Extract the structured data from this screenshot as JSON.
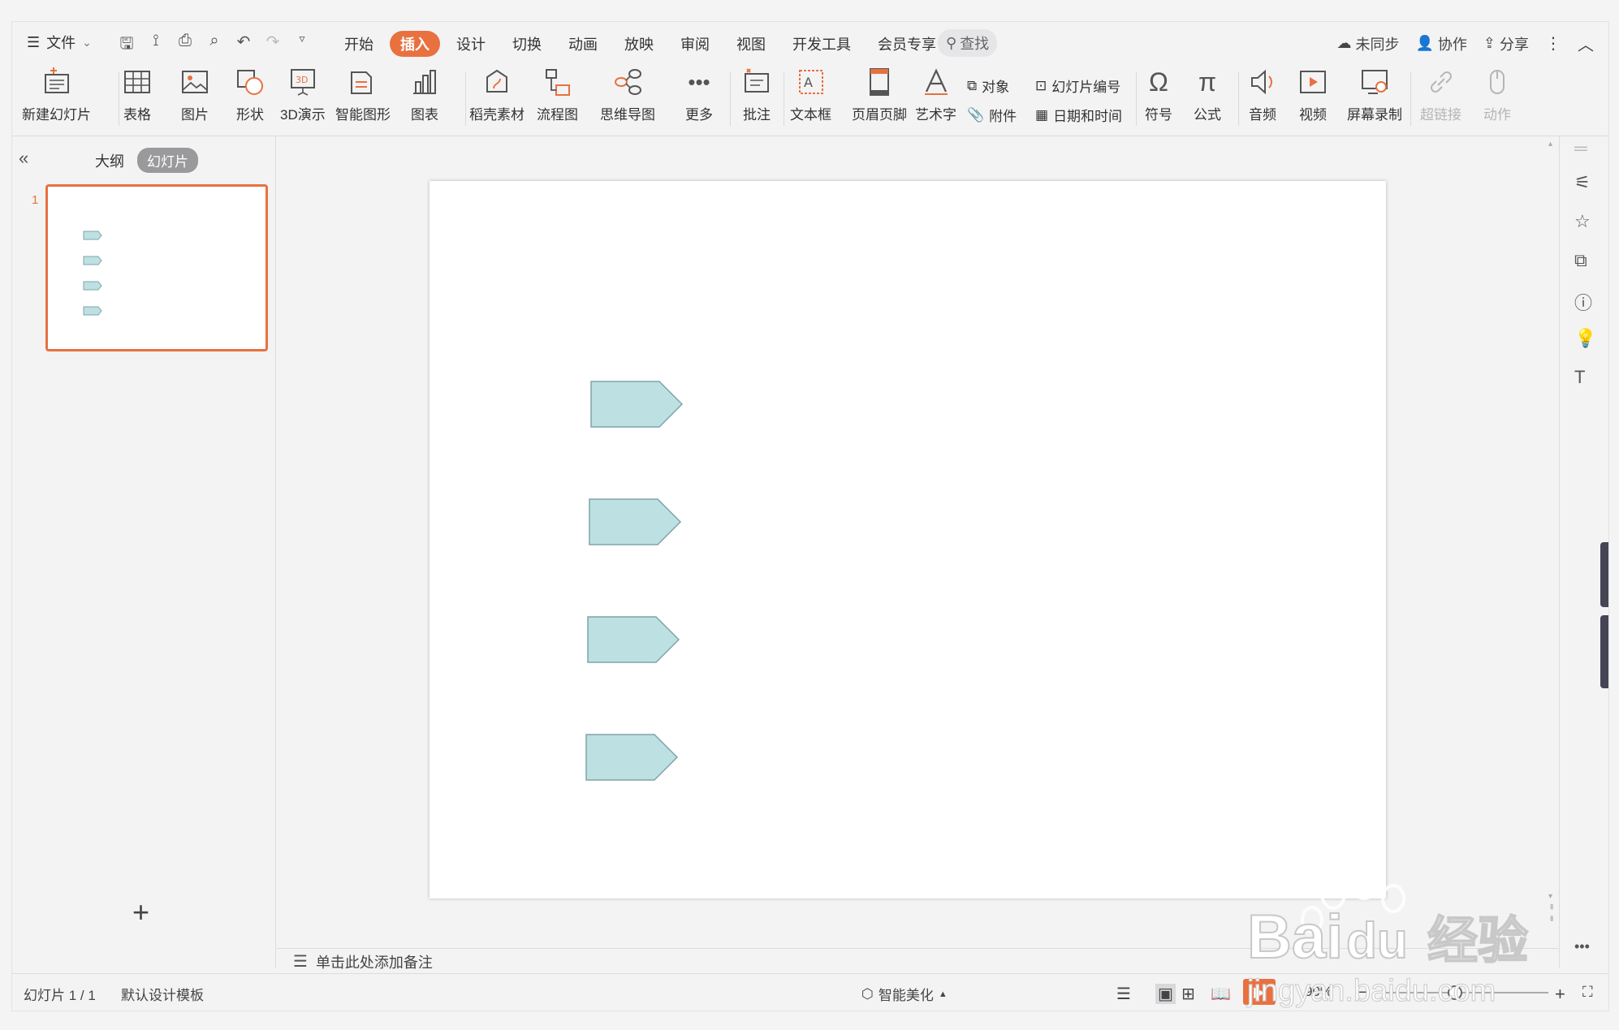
{
  "menu": {
    "file_label": "文件",
    "tabs": [
      "开始",
      "插入",
      "设计",
      "切换",
      "动画",
      "放映",
      "审阅",
      "视图",
      "开发工具",
      "会员专享"
    ],
    "active_tab": "插入",
    "search_label": "查找",
    "right_items": [
      "未同步",
      "协作",
      "分享"
    ]
  },
  "ribbon": {
    "new_slide": "新建幻灯片",
    "table": "表格",
    "picture": "图片",
    "shape": "形状",
    "demo3d": "3D演示",
    "smartart": "智能图形",
    "chart": "图表",
    "material": "稻壳素材",
    "flowchart": "流程图",
    "mindmap": "思维导图",
    "more": "更多",
    "comment": "批注",
    "textbox": "文本框",
    "header_footer": "页眉页脚",
    "wordart": "艺术字",
    "object": "对象",
    "attachment": "附件",
    "slide_number": "幻灯片编号",
    "date_time": "日期和时间",
    "symbol": "符号",
    "formula": "公式",
    "audio": "音频",
    "video": "视频",
    "screen_record": "屏幕录制",
    "hyperlink": "超链接",
    "action": "动作"
  },
  "panel": {
    "tab_outline": "大纲",
    "tab_slides": "幻灯片",
    "thumb_number": "1"
  },
  "notes": {
    "placeholder": "单击此处添加备注"
  },
  "status": {
    "slide_info": "幻灯片 1 / 1",
    "template": "默认设计模板",
    "beautify": "智能美化",
    "zoom": "90%"
  },
  "watermark": {
    "brand": "Bai",
    "brand_tail": "du",
    "cn": "经验",
    "url": "jingyan.baidu.com"
  },
  "colors": {
    "accent": "#e8713f",
    "shape_fill": "#bde0e2",
    "shape_stroke": "#7fa4aa"
  },
  "slide": {
    "shapes": [
      "pentagon-arrow-1",
      "pentagon-arrow-2",
      "pentagon-arrow-3",
      "pentagon-arrow-4"
    ]
  }
}
